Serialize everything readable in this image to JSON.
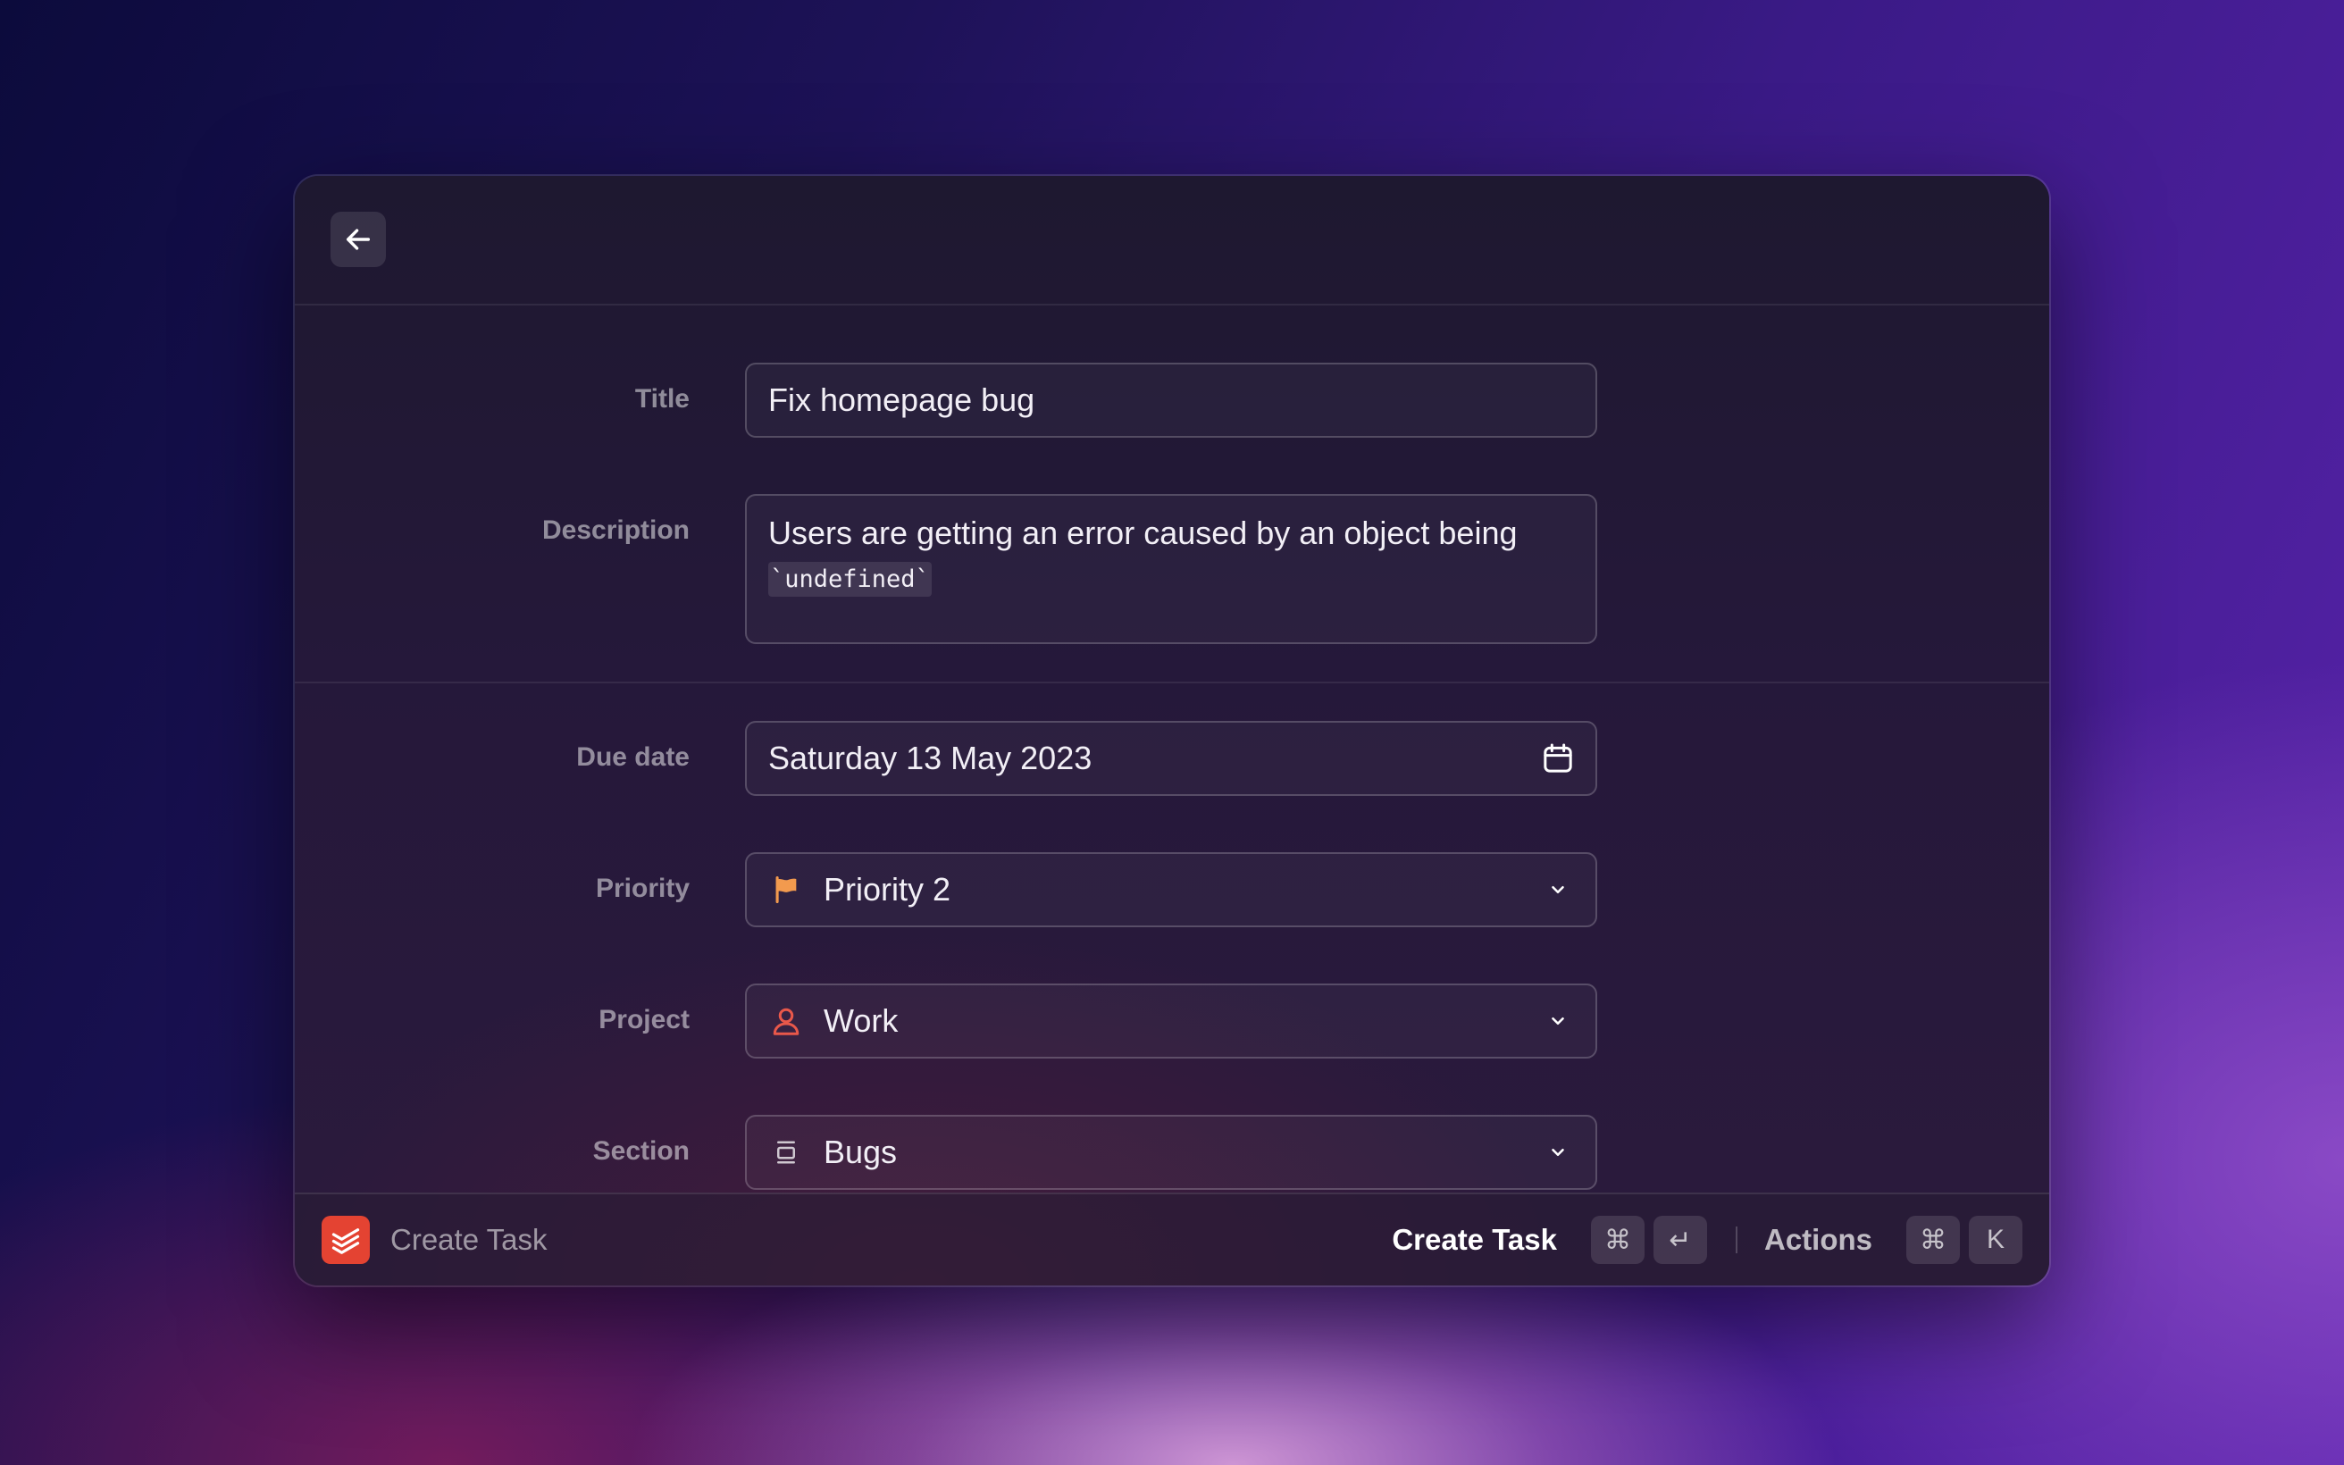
{
  "header": {
    "back_icon": "arrow-left-icon"
  },
  "form": {
    "title": {
      "label": "Title",
      "value": "Fix homepage bug"
    },
    "description": {
      "label": "Description",
      "text": "Users are getting an error caused by an object being",
      "code": "`undefined`"
    },
    "due_date": {
      "label": "Due date",
      "value": "Saturday 13 May 2023",
      "icon": "calendar-icon"
    },
    "priority": {
      "label": "Priority",
      "value": "Priority 2",
      "icon": "flag-icon",
      "icon_color": "#f29a4e"
    },
    "project": {
      "label": "Project",
      "value": "Work",
      "icon": "person-icon",
      "icon_color": "#e8584a"
    },
    "section": {
      "label": "Section",
      "value": "Bugs",
      "icon": "section-icon"
    }
  },
  "footer": {
    "app_icon": "todoist-logo-icon",
    "title": "Create Task",
    "primary_action": "Create Task",
    "primary_keys": [
      "⌘",
      "↵"
    ],
    "secondary_action": "Actions",
    "secondary_keys": [
      "⌘",
      "K"
    ]
  },
  "colors": {
    "brand": "#e44332",
    "priority_flag": "#f29a4e",
    "project_icon": "#e8584a"
  }
}
